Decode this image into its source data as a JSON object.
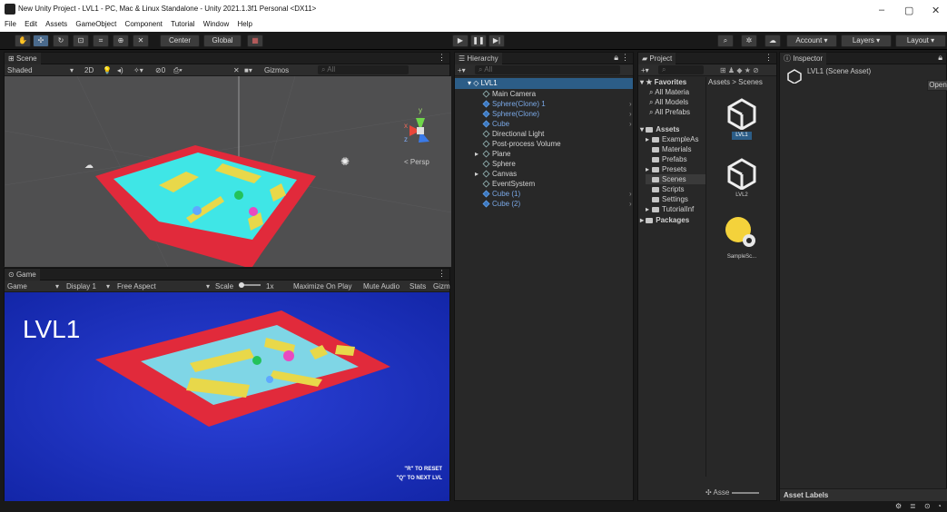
{
  "window": {
    "title": "New Unity Project - LVL1 - PC, Mac & Linux Standalone - Unity 2021.1.3f1 Personal <DX11>",
    "minimize": "–",
    "maximize": "▢",
    "close": "✕"
  },
  "menu": [
    "File",
    "Edit",
    "Assets",
    "GameObject",
    "Component",
    "Tutorial",
    "Window",
    "Help"
  ],
  "toolbar": {
    "center": "Center",
    "global": "Global",
    "play": "▶",
    "pause": "❚❚",
    "step": "▶|",
    "account": "Account",
    "layers": "Layers",
    "layout": "Layout"
  },
  "scene": {
    "tab": "Scene",
    "shading": "Shaded",
    "mode2d": "2D",
    "gizmos": "Gizmos",
    "search_placeholder": "All",
    "persp": "< Persp",
    "axis_y": "y",
    "axis_x": "x",
    "axis_z": "z"
  },
  "game": {
    "tab": "Game",
    "display_mode": "Game",
    "display": "Display 1",
    "aspect": "Free Aspect",
    "scale_label": "Scale",
    "scale_value": "1x",
    "maximize": "Maximize On Play",
    "mute": "Mute Audio",
    "stats": "Stats",
    "gizmos": "Gizm",
    "level_label": "LVL1",
    "hint_reset": "\"R\" TO RESET",
    "hint_next": "\"Q\" TO NEXT LVL"
  },
  "hierarchy": {
    "tab": "Hierarchy",
    "search_placeholder": "All",
    "root": "LVL1",
    "items": [
      {
        "label": "Main Camera",
        "blue": false,
        "arrow": false,
        "chev": false
      },
      {
        "label": "Sphere(Clone) 1",
        "blue": true,
        "arrow": false,
        "chev": true
      },
      {
        "label": "Sphere(Clone)",
        "blue": true,
        "arrow": false,
        "chev": true
      },
      {
        "label": "Cube",
        "blue": true,
        "arrow": false,
        "chev": true
      },
      {
        "label": "Directional Light",
        "blue": false,
        "arrow": false,
        "chev": false
      },
      {
        "label": "Post-process Volume",
        "blue": false,
        "arrow": false,
        "chev": false
      },
      {
        "label": "Plane",
        "blue": false,
        "arrow": true,
        "chev": false
      },
      {
        "label": "Sphere",
        "blue": false,
        "arrow": false,
        "chev": false
      },
      {
        "label": "Canvas",
        "blue": false,
        "arrow": true,
        "chev": false
      },
      {
        "label": "EventSystem",
        "blue": false,
        "arrow": false,
        "chev": false
      },
      {
        "label": "Cube (1)",
        "blue": true,
        "arrow": false,
        "chev": true
      },
      {
        "label": "Cube (2)",
        "blue": true,
        "arrow": false,
        "chev": true
      }
    ]
  },
  "project": {
    "tab": "Project",
    "favorites": "Favorites",
    "fav_items": [
      "All Materia",
      "All Models",
      "All Prefabs"
    ],
    "assets": "Assets",
    "asset_items": [
      "ExampleAs",
      "Materials",
      "Prefabs",
      "Presets",
      "Scenes",
      "Scripts",
      "Settings",
      "TutorialInf"
    ],
    "packages": "Packages",
    "breadcrumb_root": "Assets",
    "breadcrumb_sep": ">",
    "breadcrumb_current": "Scenes",
    "files": [
      "LVL1",
      "LVL2",
      "SampleSc..."
    ],
    "footer_label": "Asse"
  },
  "inspector": {
    "tab": "Inspector",
    "asset_name": "LVL1 (Scene Asset)",
    "open_button": "Open",
    "asset_labels": "Asset Labels"
  },
  "colors": {
    "wall_red": "#e12a3b",
    "floor_cyan": "#3fe6e6",
    "block_yellow": "#e8d84a",
    "game_bg": "#1c2fc2",
    "selection_blue": "#2c5d87"
  }
}
